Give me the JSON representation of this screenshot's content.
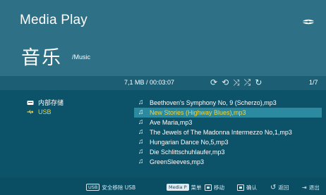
{
  "header": {
    "app_title": "Media Play",
    "section_title": "音乐",
    "path": "/Music",
    "logo_icon": "brand-logo"
  },
  "status_bar": {
    "file_info": "7,1 MB / 00:03:07",
    "page_indicator": "1/7",
    "playback_icons": [
      "repeat-icon",
      "repeat-all-icon",
      "shuffle-icon",
      "shuffle-repeat-icon"
    ]
  },
  "devices": [
    {
      "label": "内部存储",
      "icon": "internal-storage-icon",
      "active": false
    },
    {
      "label": "USB",
      "icon": "usb-icon",
      "active": true
    }
  ],
  "files": [
    {
      "name": "Beethoven's Symphony No, 9 (Scherzo),mp3",
      "selected": false
    },
    {
      "name": "New Stories (Highway Blues),mp3",
      "selected": true
    },
    {
      "name": "Ave Maria,mp3",
      "selected": false
    },
    {
      "name": "The Jewels of The Madonna Intermezzo No,1,mp3",
      "selected": false
    },
    {
      "name": "Hungarian Dance No,5,mp3",
      "selected": false
    },
    {
      "name": "Die Schlittschuhlaufer,mp3",
      "selected": false
    },
    {
      "name": "GreenSleeves,mp3",
      "selected": false
    }
  ],
  "footer": {
    "safe_remove": {
      "key": "USB",
      "label": "安全移除 USB"
    },
    "menu": {
      "key": "Media P",
      "label": "菜单"
    },
    "move": {
      "label": "移动"
    },
    "confirm": {
      "label": "确认"
    },
    "back": {
      "label": "返回"
    },
    "exit": {
      "label": "退出"
    }
  },
  "colors": {
    "header_bg": "#2e7186",
    "panel_bg": "#0c536a",
    "info_bar_bg": "#1c5f74",
    "selection_bg": "#2c8aa0",
    "highlight_text": "#f1d53a",
    "footer_bg": "#0a4e64"
  }
}
